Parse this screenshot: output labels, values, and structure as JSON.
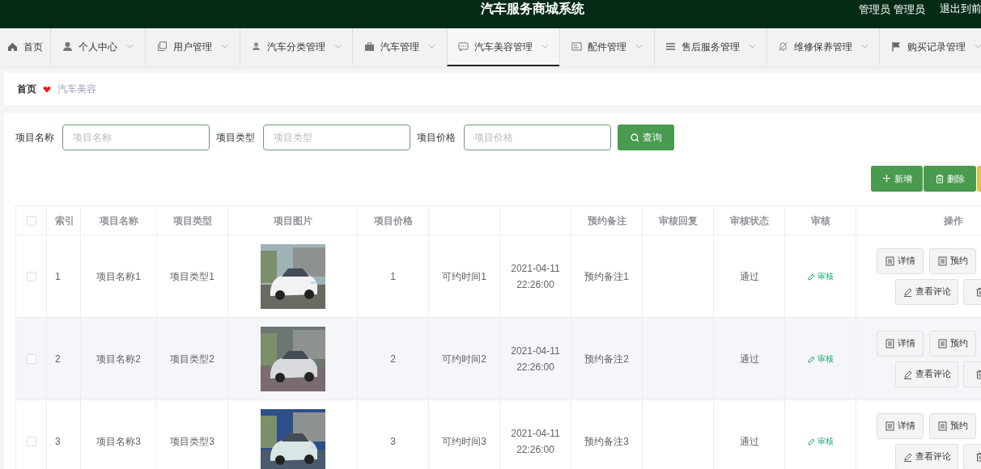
{
  "header": {
    "title": "汽车服务商城系统",
    "user": "管理员 管理员",
    "logout": "退出到前"
  },
  "nav": [
    {
      "label": "首页",
      "dropdown": false,
      "selected": false
    },
    {
      "label": "个人中心",
      "dropdown": true,
      "selected": false
    },
    {
      "label": "用户管理",
      "dropdown": true,
      "selected": false
    },
    {
      "label": "汽车分类管理",
      "dropdown": true,
      "selected": false
    },
    {
      "label": "汽车管理",
      "dropdown": true,
      "selected": false
    },
    {
      "label": "汽车美容管理",
      "dropdown": true,
      "selected": true
    },
    {
      "label": "配件管理",
      "dropdown": true,
      "selected": false
    },
    {
      "label": "售后服务管理",
      "dropdown": true,
      "selected": false
    },
    {
      "label": "维修保养管理",
      "dropdown": true,
      "selected": false
    },
    {
      "label": "购买记录管理",
      "dropdown": true,
      "selected": false
    }
  ],
  "breadcrumb": [
    {
      "label": "首页",
      "current": false
    },
    {
      "label": "汽车美容",
      "current": true
    }
  ],
  "search": {
    "fields": [
      {
        "label": "项目名称",
        "placeholder": "项目名称"
      },
      {
        "label": "项目类型",
        "placeholder": "项目类型"
      },
      {
        "label": "项目价格",
        "placeholder": "项目价格"
      }
    ],
    "button": "查询"
  },
  "toolbar": [
    {
      "kind": "add",
      "label": "新增"
    },
    {
      "kind": "delete",
      "label": "删除"
    },
    {
      "kind": "partial"
    }
  ],
  "table": {
    "header_checkbox": {
      "checked": false
    },
    "columns": [
      {
        "label": "索引"
      },
      {
        "label": "项目名称"
      },
      {
        "label": "项目类型"
      },
      {
        "label": "项目图片"
      },
      {
        "label": "项目价格"
      },
      {},
      {},
      {
        "label": "预约备注"
      },
      {
        "label": "审核回复"
      },
      {
        "label": "审核状态"
      },
      {
        "label": "审核"
      },
      {
        "label": "操作"
      }
    ],
    "rows": [
      {
        "checked": false,
        "cells": [
          "1",
          "项目名称1",
          "项目类型1",
          {
            "kind": "picture"
          },
          "1",
          "可约时间1",
          "2021-04-11 22:26:00",
          "预约备注1",
          null,
          "通过"
        ],
        "review": "审核",
        "actions": [
          {
            "kind": "detail",
            "label": "详情"
          },
          {
            "kind": "book",
            "label": "预约"
          },
          {
            "kind": "comment",
            "label": "查看评论"
          },
          {
            "kind": "delete"
          }
        ]
      },
      {
        "checked": false,
        "cells": [
          "2",
          "项目名称2",
          "项目类型2",
          {
            "kind": "picture"
          },
          "2",
          "可约时间2",
          "2021-04-11 22:26:00",
          "预约备注2",
          null,
          "通过"
        ],
        "review": "审核",
        "actions": [
          {
            "kind": "detail",
            "label": "详情"
          },
          {
            "kind": "book",
            "label": "预约"
          },
          {
            "kind": "comment",
            "label": "查看评论"
          },
          {
            "kind": "delete"
          }
        ]
      },
      {
        "checked": false,
        "cells": [
          "3",
          "项目名称3",
          "项目类型3",
          {
            "kind": "picture"
          },
          "3",
          "可约时间3",
          "2021-04-11 22:26:00",
          "预约备注3",
          null,
          "通过"
        ],
        "review": "审核",
        "actions": [
          {
            "kind": "detail",
            "label": "详情"
          },
          {
            "kind": "book",
            "label": "预约"
          },
          {
            "kind": "comment",
            "label": "查看评论"
          },
          {
            "kind": "delete"
          }
        ]
      }
    ]
  }
}
